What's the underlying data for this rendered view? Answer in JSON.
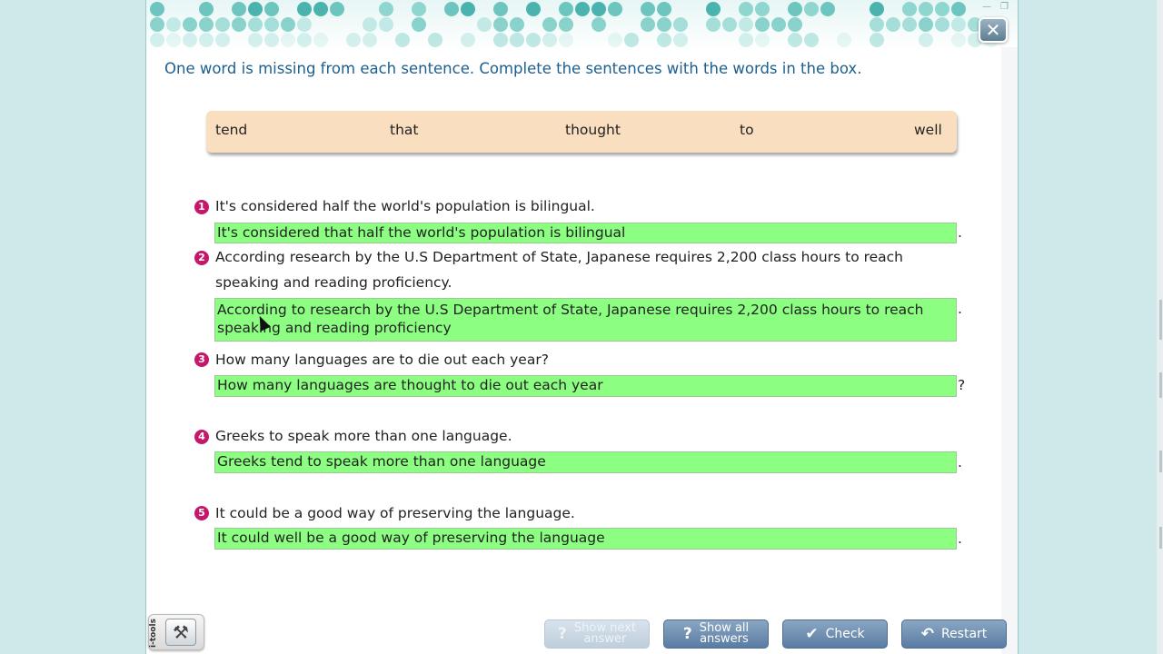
{
  "window": {
    "minimize": "—",
    "restore": "❐",
    "close_icon": "✕"
  },
  "instruction": "One word is missing from each sentence. Complete the sentences with the words in the box.",
  "word_box": [
    "tend",
    "that",
    "thought",
    "to",
    "well"
  ],
  "questions": [
    {
      "number": "1",
      "text": "It's considered half the world's population is bilingual.",
      "answer": "It's considered that half the world's population is bilingual",
      "end_punct": "."
    },
    {
      "number": "2",
      "text": "According research by the U.S Department of State, Japanese requires 2,200 class hours to reach speaking and reading proficiency.",
      "answer": "According to research by the U.S Department of State, Japanese requires 2,200 class hours to reach speaking and reading proficiency",
      "end_punct": "."
    },
    {
      "number": "3",
      "text": "How many languages are to die out each year?",
      "answer": "How many languages are thought to die out each year",
      "end_punct": "?"
    },
    {
      "number": "4",
      "text": "Greeks to speak more than one language.",
      "answer": "Greeks tend to speak more than one language",
      "end_punct": "."
    },
    {
      "number": "5",
      "text": "It could be a good way of preserving the language.",
      "answer": "It could well be a good way of preserving the language",
      "end_punct": "."
    }
  ],
  "toolbar": {
    "itools_label": "i-tools",
    "itools_icon": "tools-icon",
    "show_next_line1": "Show next",
    "show_next_line2": "answer",
    "show_all_line1": "Show all",
    "show_all_line2": "answers",
    "check": "Check",
    "restart": "Restart"
  },
  "colors": {
    "accent_blue": "#1d5f8f",
    "number_badge": "#c5186b",
    "answer_green": "#8cff82",
    "word_box_bg": "#f9dfc0"
  }
}
